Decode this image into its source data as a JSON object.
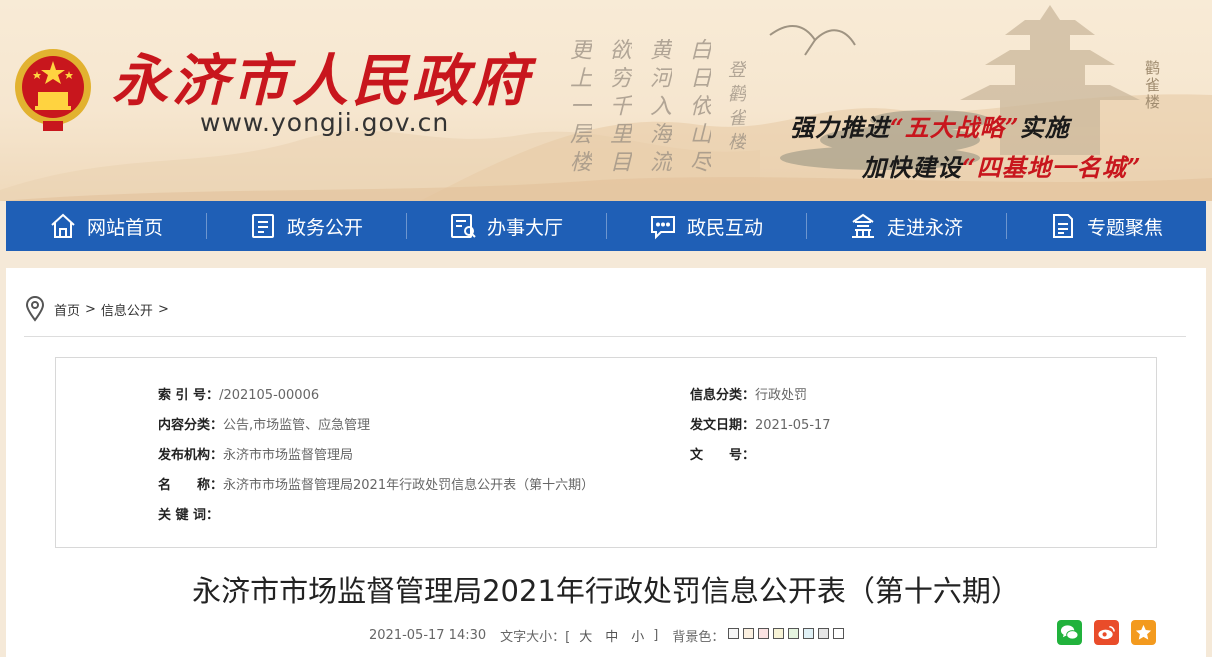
{
  "header": {
    "site_title": "永济市人民政府",
    "site_url": "www.yongji.gov.cn",
    "calligraphy_columns": [
      "白日依山尽",
      "黄河入海流",
      "欲穷千里目",
      "更上一层楼",
      "登鹳雀楼"
    ],
    "tower_label": "鹳雀楼",
    "slogan1": {
      "prefix": "强力推进",
      "highlight": "“五大战略”",
      "suffix": "实施"
    },
    "slogan2": {
      "prefix": "加快建设",
      "highlight": "“四基地一名城”",
      "suffix": ""
    },
    "brand_red": "#c8161d"
  },
  "nav": {
    "color": "#1f5fb6",
    "items": [
      {
        "label": "网站首页",
        "icon": "home-icon"
      },
      {
        "label": "政务公开",
        "icon": "document-list-icon"
      },
      {
        "label": "办事大厅",
        "icon": "service-hall-icon"
      },
      {
        "label": "政民互动",
        "icon": "chat-bubble-icon"
      },
      {
        "label": "走进永济",
        "icon": "pavilion-icon"
      },
      {
        "label": "专题聚焦",
        "icon": "topic-document-icon"
      }
    ]
  },
  "breadcrumb": {
    "icon": "location-pin-icon",
    "home": "首页",
    "separator": ">",
    "current": "信息公开"
  },
  "meta": {
    "index_label": "索 引 号：",
    "index_value": "/202105-00006",
    "category_label": "信息分类：",
    "category_value": "行政处罚",
    "content_label": "内容分类：",
    "content_value": "公告,市场监管、应急管理",
    "date_label": "发文日期：",
    "date_value": "2021-05-17",
    "publisher_label": "发布机构：",
    "publisher_value": "永济市市场监督管理局",
    "docno_label": "文　　号：",
    "docno_value": "",
    "name_label": "名　　称：",
    "name_value": "永济市市场监督管理局2021年行政处罚信息公开表（第十六期）",
    "keywords_label": "关 键 词：",
    "keywords_value": ""
  },
  "article": {
    "title": "永济市市场监督管理局2021年行政处罚信息公开表（第十六期）",
    "datetime": "2021-05-17 14:30",
    "font_size_label": "文字大小：[",
    "size_large": "大",
    "size_medium": "中",
    "size_small": "小",
    "font_size_end": "]",
    "bg_label": "背景色：",
    "bg_colors": [
      "#f7f7f7",
      "#fbf0e0",
      "#fbe3e3",
      "#f7f3d6",
      "#e6f5e0",
      "#e0f1f6",
      "#e6e6e6",
      "#ffffff"
    ]
  },
  "share": [
    {
      "icon": "wechat-icon",
      "color": "#21b23c"
    },
    {
      "icon": "weibo-icon",
      "color": "#e94c2a"
    },
    {
      "icon": "favorite-star-icon",
      "color": "#f39a1e"
    }
  ]
}
